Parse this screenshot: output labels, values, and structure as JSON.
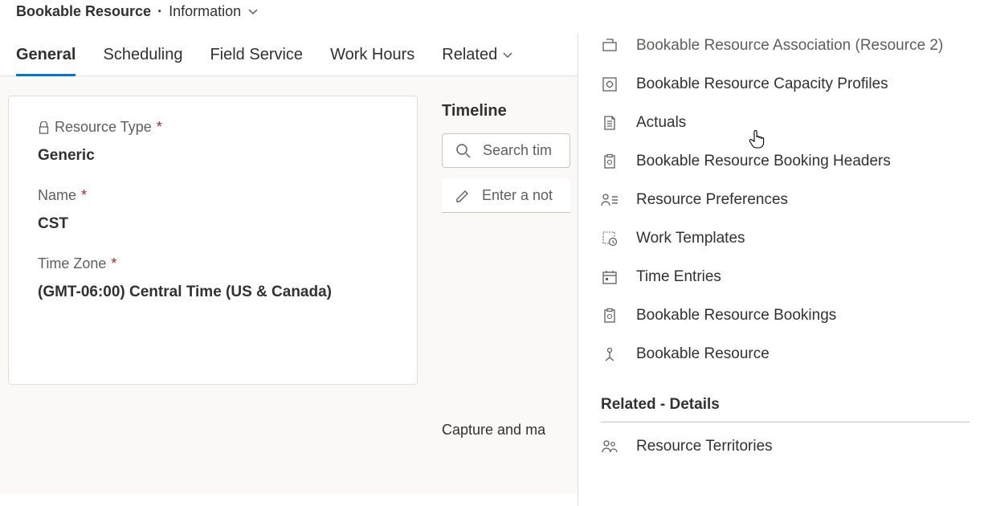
{
  "header": {
    "entity": "Bookable Resource",
    "separator": "·",
    "form_name": "Information"
  },
  "tabs": [
    {
      "label": "General",
      "active": true
    },
    {
      "label": "Scheduling",
      "active": false
    },
    {
      "label": "Field Service",
      "active": false
    },
    {
      "label": "Work Hours",
      "active": false
    },
    {
      "label": "Related",
      "active": false,
      "has_chevron": true
    }
  ],
  "card": {
    "fields": [
      {
        "label": "Resource Type",
        "required": true,
        "locked": true,
        "value": "Generic"
      },
      {
        "label": "Name",
        "required": true,
        "locked": false,
        "value": "CST"
      },
      {
        "label": "Time Zone",
        "required": true,
        "locked": false,
        "value": "(GMT-06:00) Central Time (US & Canada)"
      }
    ]
  },
  "timeline": {
    "title": "Timeline",
    "search_placeholder": "Search tim",
    "note_placeholder": "Enter a not",
    "footer": "Capture and ma"
  },
  "related_menu": {
    "truncated_top": "Bookable Resource Association (Resource 2)",
    "items": [
      {
        "icon": "capacity",
        "label": "Bookable Resource Capacity Profiles"
      },
      {
        "icon": "document",
        "label": "Actuals"
      },
      {
        "icon": "clipboard-gear",
        "label": "Bookable Resource Booking Headers"
      },
      {
        "icon": "person-list",
        "label": "Resource Preferences"
      },
      {
        "icon": "template-clock",
        "label": "Work Templates"
      },
      {
        "icon": "calendar",
        "label": "Time Entries"
      },
      {
        "icon": "clipboard-gear",
        "label": "Bookable Resource Bookings"
      },
      {
        "icon": "person-pin",
        "label": "Bookable Resource"
      }
    ],
    "section_header": "Related - Details",
    "section_items": [
      {
        "icon": "people",
        "label": "Resource Territories"
      }
    ]
  }
}
